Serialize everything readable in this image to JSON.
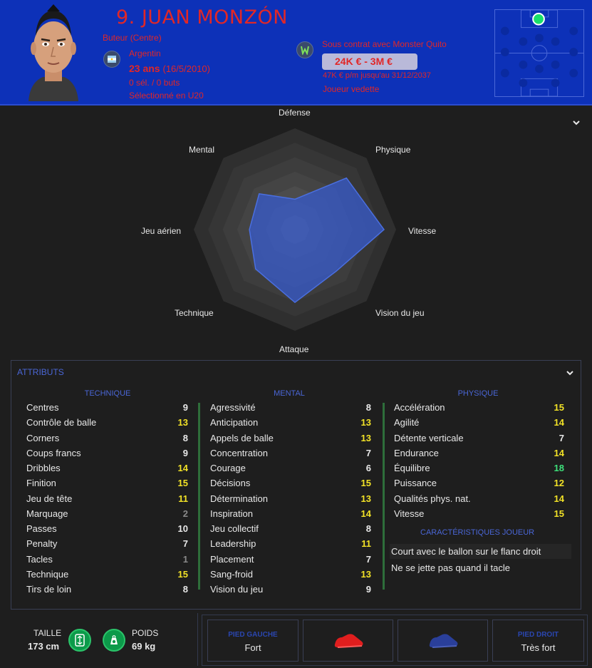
{
  "header": {
    "name": "9. JUAN MONZÓN",
    "position": "Buteur (Centre)",
    "nationality": "Argentin",
    "age": "23 ans",
    "dob": "(16/5/2010)",
    "caps": "0 sél. / 0 buts",
    "selection": "Sélectionné en U20",
    "contract": "Sous contrat avec Monster Quito",
    "value": "24K € - 3M €",
    "wage": "47K € p/m jusqu'au 31/12/2037",
    "status": "Joueur vedette",
    "accent_color": "#e12727",
    "bg_color": "#0d31b8"
  },
  "radar": {
    "labels": {
      "defense": "Défense",
      "physique": "Physique",
      "vitesse": "Vitesse",
      "vision": "Vision du jeu",
      "attaque": "Attaque",
      "technique": "Technique",
      "aerien": "Jeu aérien",
      "mental": "Mental"
    },
    "order": [
      "Défense",
      "Physique",
      "Vitesse",
      "Vision du jeu",
      "Attaque",
      "Technique",
      "Jeu aérien",
      "Mental"
    ],
    "values": [
      0.3,
      0.72,
      0.88,
      0.58,
      0.72,
      0.55,
      0.45,
      0.5
    ]
  },
  "attributes": {
    "title": "ATTRIBUTS",
    "technique_head": "TECHNIQUE",
    "mental_head": "MENTAL",
    "physique_head": "PHYSIQUE",
    "technique": [
      {
        "name": "Centres",
        "value": "9"
      },
      {
        "name": "Contrôle de balle",
        "value": "13"
      },
      {
        "name": "Corners",
        "value": "8"
      },
      {
        "name": "Coups francs",
        "value": "9"
      },
      {
        "name": "Dribbles",
        "value": "14"
      },
      {
        "name": "Finition",
        "value": "15"
      },
      {
        "name": "Jeu de tête",
        "value": "11"
      },
      {
        "name": "Marquage",
        "value": "2"
      },
      {
        "name": "Passes",
        "value": "10"
      },
      {
        "name": "Penalty",
        "value": "7"
      },
      {
        "name": "Tacles",
        "value": "1"
      },
      {
        "name": "Technique",
        "value": "15"
      },
      {
        "name": "Tirs de loin",
        "value": "8"
      }
    ],
    "mental": [
      {
        "name": "Agressivité",
        "value": "8"
      },
      {
        "name": "Anticipation",
        "value": "13"
      },
      {
        "name": "Appels de balle",
        "value": "13"
      },
      {
        "name": "Concentration",
        "value": "7"
      },
      {
        "name": "Courage",
        "value": "6"
      },
      {
        "name": "Décisions",
        "value": "15"
      },
      {
        "name": "Détermination",
        "value": "13"
      },
      {
        "name": "Inspiration",
        "value": "14"
      },
      {
        "name": "Jeu collectif",
        "value": "8"
      },
      {
        "name": "Leadership",
        "value": "11"
      },
      {
        "name": "Placement",
        "value": "7"
      },
      {
        "name": "Sang-froid",
        "value": "13"
      },
      {
        "name": "Vision du jeu",
        "value": "9"
      }
    ],
    "physique": [
      {
        "name": "Accélération",
        "value": "15"
      },
      {
        "name": "Agilité",
        "value": "14"
      },
      {
        "name": "Détente verticale",
        "value": "7"
      },
      {
        "name": "Endurance",
        "value": "14"
      },
      {
        "name": "Équilibre",
        "value": "18"
      },
      {
        "name": "Puissance",
        "value": "12"
      },
      {
        "name": "Qualités phys. nat.",
        "value": "14"
      },
      {
        "name": "Vitesse",
        "value": "15"
      }
    ],
    "traits_head": "CARACTÉRISTIQUES JOUEUR",
    "traits": [
      "Court avec le ballon sur le flanc droit",
      "Ne se jette pas quand il tacle"
    ]
  },
  "stats": {
    "height_label": "TAILLE",
    "height": "173 cm",
    "weight_label": "POIDS",
    "weight": "69 kg"
  },
  "feet": {
    "left_label": "PIED GAUCHE",
    "left_value": "Fort",
    "right_label": "PIED DROIT",
    "right_value": "Très fort"
  }
}
